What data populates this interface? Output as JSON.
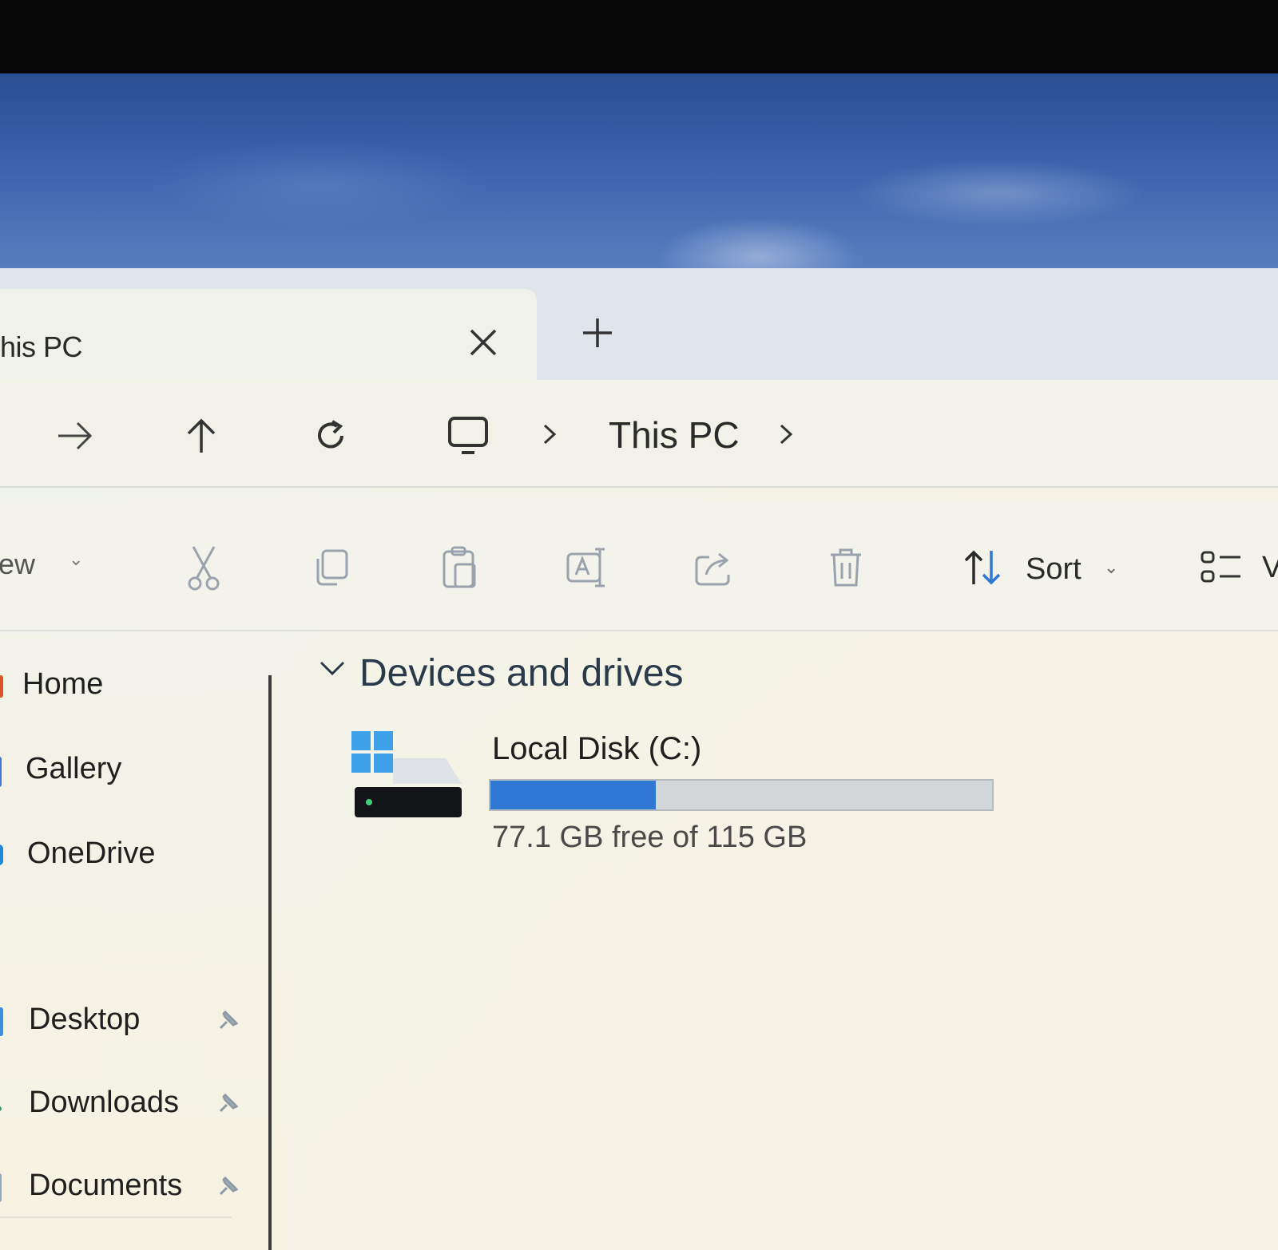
{
  "tab": {
    "title": "his PC"
  },
  "address": {
    "crumb": "This PC"
  },
  "toolbar": {
    "new_label": "lew",
    "sort_label": "Sort",
    "view_label": "V"
  },
  "sidebar": {
    "items": [
      {
        "label": "Home"
      },
      {
        "label": "Gallery"
      },
      {
        "label": "OneDrive"
      },
      {
        "label": "Desktop"
      },
      {
        "label": "Downloads"
      },
      {
        "label": "Documents"
      }
    ]
  },
  "main": {
    "section_title": "Devices and drives",
    "drives": [
      {
        "name": "Local Disk (C:)",
        "free_text": "77.1 GB free of 115 GB",
        "used_fraction": 0.33
      }
    ]
  },
  "colors": {
    "accent": "#2f79d4",
    "tab_bg": "#f0f1ea",
    "tabbar_bg": "#dfe5ea"
  },
  "icons": [
    "close-icon",
    "plus-icon",
    "forward-arrow-icon",
    "up-arrow-icon",
    "refresh-icon",
    "monitor-icon",
    "chevron-right-icon",
    "cut-icon",
    "copy-icon",
    "paste-icon",
    "rename-icon",
    "share-icon",
    "delete-icon",
    "sort-icon",
    "view-icon",
    "chevron-down-icon",
    "pin-icon",
    "windows-logo-icon",
    "drive-icon"
  ]
}
